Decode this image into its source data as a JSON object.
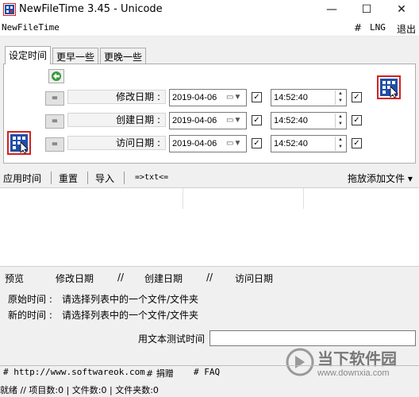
{
  "window": {
    "title": "NewFileTime 3.45 - Unicode",
    "icon": "newfiletime-app-icon",
    "controls": {
      "minimize": "—",
      "maximize": "☐",
      "close": "✕"
    }
  },
  "menu": {
    "app_name": "NewFileTime",
    "hash": "#",
    "lng": "LNG",
    "exit": "退出"
  },
  "tabs": [
    {
      "label": "设定时间",
      "active": true
    },
    {
      "label": "更早一些",
      "active": false
    },
    {
      "label": "更晚一些",
      "active": false
    }
  ],
  "settings": {
    "eq_label": "=",
    "rows": [
      {
        "label": "修改日期 :",
        "date": "2019-04-06",
        "date_checked": true,
        "time": "14:52:40",
        "time_checked": true
      },
      {
        "label": "创建日期 :",
        "date": "2019-04-06",
        "date_checked": true,
        "time": "14:52:40",
        "time_checked": true
      },
      {
        "label": "访问日期 :",
        "date": "2019-04-06",
        "date_checked": true,
        "time": "14:52:40",
        "time_checked": true
      }
    ]
  },
  "toolbar": {
    "apply": "应用时间",
    "reset": "重置",
    "import": "导入",
    "to_txt": "=>txt<=",
    "drop_files": "拖放添加文件 ▾"
  },
  "preview": {
    "label": "预览",
    "modified": "修改日期",
    "sep": "//",
    "created": "创建日期",
    "accessed": "访问日期",
    "original_label": "原始时间 :",
    "original_value": "请选择列表中的一个文件/文件夹",
    "new_label": "新的时间 :",
    "new_value": "请选择列表中的一个文件/文件夹",
    "test_label": "用文本测试时间",
    "test_value": ""
  },
  "links": {
    "website": "# http://www.softwareok.com",
    "donate": "# 捐赠",
    "faq": "# FAQ"
  },
  "status": {
    "text": "就绪 // 项目数:0 | 文件数:0 | 文件夹数:0"
  },
  "watermark": {
    "name": "当下软件园",
    "url": "www.downxia.com"
  },
  "colors": {
    "accent_blue": "#1f4fa8",
    "icon_red": "#d62020",
    "refresh_green": "#3a9a3a"
  }
}
